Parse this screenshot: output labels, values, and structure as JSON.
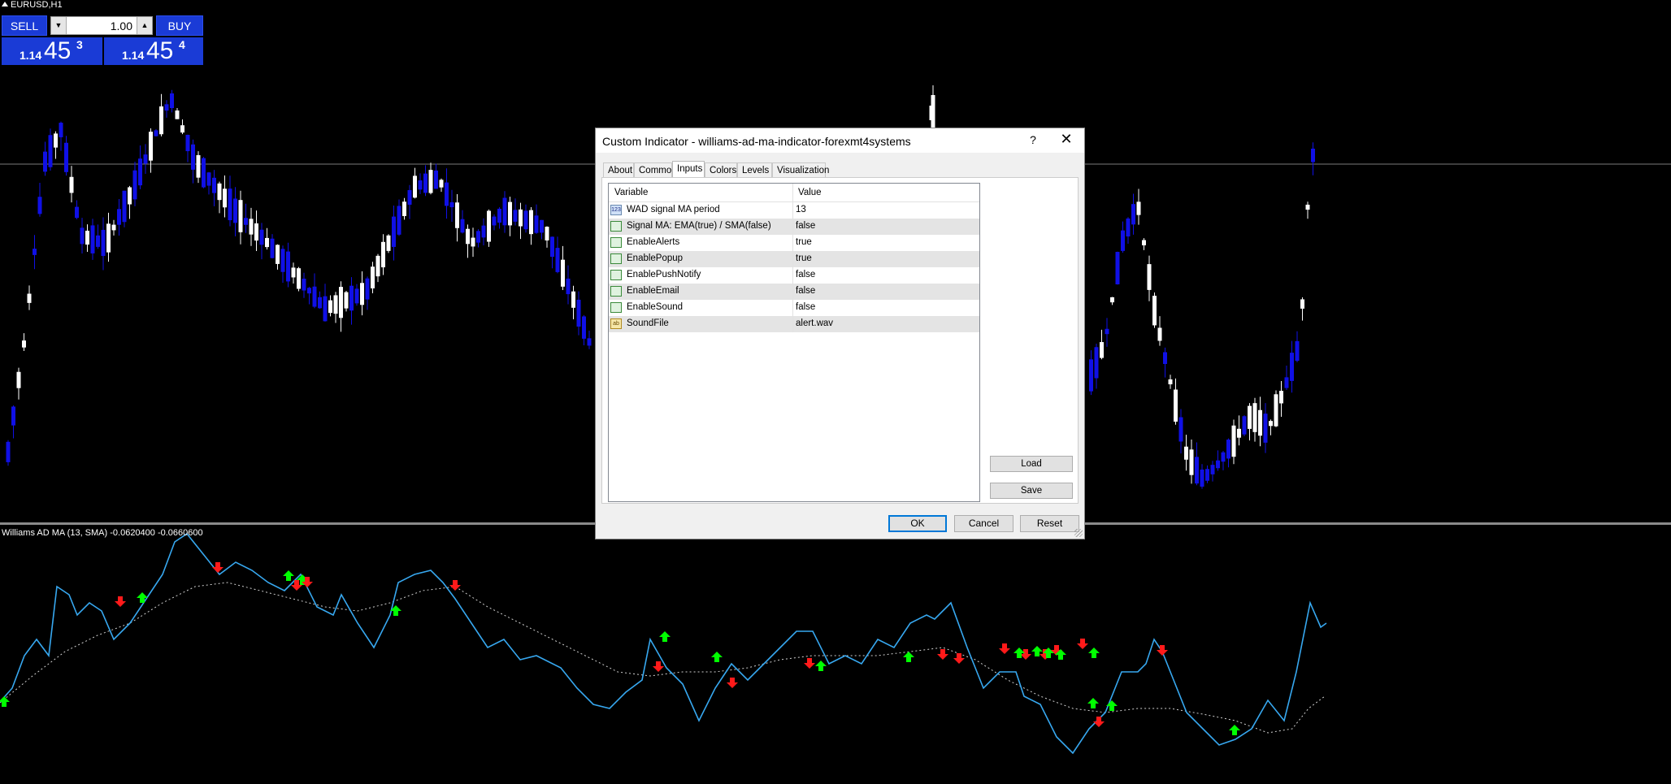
{
  "chart": {
    "symbol_label": "EURUSD,H1",
    "indicator_label": "Williams AD MA (13, SMA) -0.0620400 -0.0660600",
    "colors": {
      "bull": "#ffffff",
      "bear": "#1010e6",
      "ind_line": "#37a8f0",
      "signal_line": "#d0d0d0",
      "buy_arrow": "#00ff00",
      "sell_arrow": "#ff1a1a"
    }
  },
  "one_click": {
    "sell_label": "SELL",
    "buy_label": "BUY",
    "lot_value": "1.00",
    "bid": {
      "small": "1.14",
      "big": "45",
      "pip": "3"
    },
    "ask": {
      "small": "1.14",
      "big": "45",
      "pip": "4"
    }
  },
  "dialog": {
    "title": "Custom Indicator - williams-ad-ma-indicator-forexmt4systems",
    "help_label": "?",
    "close_label": "✕",
    "tabs": [
      "About",
      "Common",
      "Inputs",
      "Colors",
      "Levels",
      "Visualization"
    ],
    "active_tab": "Inputs",
    "columns": {
      "variable": "Variable",
      "value": "Value"
    },
    "rows": [
      {
        "icon": "123",
        "variable": "WAD signal MA period",
        "value": "13"
      },
      {
        "icon": "bool",
        "variable": "Signal MA: EMA(true) / SMA(false)",
        "value": "false"
      },
      {
        "icon": "bool",
        "variable": "EnableAlerts",
        "value": "true"
      },
      {
        "icon": "bool",
        "variable": "EnablePopup",
        "value": "true"
      },
      {
        "icon": "bool",
        "variable": "EnablePushNotify",
        "value": "false"
      },
      {
        "icon": "bool",
        "variable": "EnableEmail",
        "value": "false"
      },
      {
        "icon": "bool",
        "variable": "EnableSound",
        "value": "false"
      },
      {
        "icon": "ab",
        "variable": "SoundFile",
        "value": "alert.wav"
      }
    ],
    "load_label": "Load",
    "save_label": "Save",
    "ok_label": "OK",
    "cancel_label": "Cancel",
    "reset_label": "Reset"
  }
}
